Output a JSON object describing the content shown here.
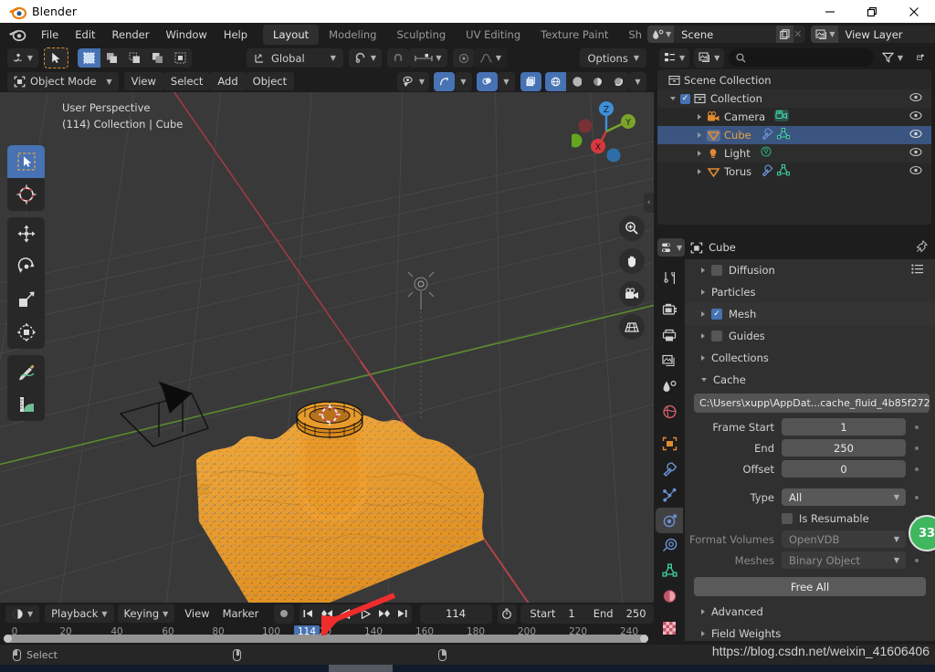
{
  "window": {
    "title": "Blender",
    "controls": {
      "minimize": "—",
      "maximize": "❐",
      "close": "✕"
    }
  },
  "topbar": {
    "menus": [
      "File",
      "Edit",
      "Render",
      "Window",
      "Help"
    ],
    "workspaces": [
      {
        "label": "Layout",
        "active": true
      },
      {
        "label": "Modeling",
        "active": false
      },
      {
        "label": "Sculpting",
        "active": false
      },
      {
        "label": "UV Editing",
        "active": false
      },
      {
        "label": "Texture Paint",
        "active": false
      },
      {
        "label": "Sh",
        "active": false
      }
    ],
    "scene": {
      "value": "Scene",
      "icon": "scene-icon"
    },
    "view_layer": {
      "value": "View Layer",
      "icon": "view-layer-icon"
    }
  },
  "viewport": {
    "tool_header": {
      "transform_orientation": "Global",
      "options_label": "Options",
      "snap_icon": "magnet-icon",
      "proportional_icon": "proportional-edit-icon"
    },
    "mode": "Object Mode",
    "menus": [
      "View",
      "Select",
      "Add",
      "Object"
    ],
    "overlay_text_line1": "User Perspective",
    "overlay_text_line2": "(114) Collection | Cube",
    "gizmo_axes": [
      "Z",
      "Y",
      "X"
    ],
    "nav_buttons": [
      "zoom-icon",
      "hand-icon",
      "camera-icon",
      "grid-icon"
    ],
    "tools": [
      "tweak-select-tool",
      "cursor-tool",
      "move-tool",
      "rotate-tool",
      "scale-tool",
      "transform-tool",
      "annotate-tool",
      "measure-tool"
    ],
    "shading_modes": [
      "wireframe",
      "solid",
      "material-preview",
      "rendered"
    ]
  },
  "timeline": {
    "playback_label": "Playback",
    "keying_label": "Keying",
    "view_label": "View",
    "marker_label": "Marker",
    "current_frame": "114",
    "start_label": "Start",
    "start_value": "1",
    "end_label": "End",
    "end_value": "250",
    "ticks": [
      "0",
      "20",
      "40",
      "60",
      "80",
      "100",
      "120",
      "140",
      "160",
      "180",
      "200",
      "220",
      "240"
    ],
    "playhead_frame": "114"
  },
  "outliner": {
    "search_placeholder": "",
    "root": "Scene Collection",
    "items": [
      {
        "label": "Collection",
        "icon": "collection-icon",
        "depth": 1,
        "checkbox": true,
        "expanded": true,
        "selected": false,
        "badges": []
      },
      {
        "label": "Camera",
        "icon": "camera-obj-icon",
        "depth": 2,
        "checkbox": false,
        "expanded": false,
        "selected": false,
        "badges": [
          "camera-data-icon"
        ]
      },
      {
        "label": "Cube",
        "icon": "mesh-obj-icon",
        "depth": 2,
        "checkbox": false,
        "expanded": false,
        "selected": true,
        "badges": [
          "modifier-icon",
          "mesh-data-icon"
        ]
      },
      {
        "label": "Light",
        "icon": "light-obj-icon",
        "depth": 2,
        "checkbox": false,
        "expanded": false,
        "selected": false,
        "badges": [
          "light-data-icon"
        ]
      },
      {
        "label": "Torus",
        "icon": "mesh-obj-icon",
        "depth": 2,
        "checkbox": false,
        "expanded": false,
        "selected": false,
        "badges": [
          "modifier-icon",
          "mesh-data-icon"
        ]
      }
    ]
  },
  "properties": {
    "breadcrumb": "Cube",
    "tabs": [
      "tool-tab",
      "render-tab",
      "output-tab",
      "view-layer-tab",
      "scene-tab",
      "world-tab",
      "object-tab",
      "modifier-tab",
      "particles-tab",
      "physics-tab",
      "constraints-tab",
      "data-tab",
      "material-tab",
      "texture-tab"
    ],
    "active_tab": "physics-tab",
    "panels": [
      {
        "label": "Diffusion",
        "checkbox": "off",
        "expanded": false,
        "has_preset": true
      },
      {
        "label": "Particles",
        "checkbox": "none",
        "expanded": false,
        "has_preset": false
      },
      {
        "label": "Mesh",
        "checkbox": "on",
        "expanded": false,
        "has_preset": false
      },
      {
        "label": "Guides",
        "checkbox": "off",
        "expanded": false,
        "has_preset": false
      },
      {
        "label": "Collections",
        "checkbox": "none",
        "expanded": false,
        "has_preset": false
      },
      {
        "label": "Cache",
        "checkbox": "none",
        "expanded": true,
        "has_preset": false
      }
    ],
    "cache_path": "C:\\Users\\xupp\\AppDat...cache_fluid_4b85f272",
    "fields": [
      {
        "label": "Frame Start",
        "value": "1",
        "type": "number",
        "dim": false
      },
      {
        "label": "End",
        "value": "250",
        "type": "number",
        "dim": false
      },
      {
        "label": "Offset",
        "value": "0",
        "type": "number",
        "dim": false
      },
      {
        "label": "Type",
        "value": "All",
        "type": "dropdown",
        "dim": false
      },
      {
        "label": "Format Volumes",
        "value": "OpenVDB",
        "type": "dropdown",
        "dim": true
      },
      {
        "label": "Meshes",
        "value": "Binary Object",
        "type": "dropdown",
        "dim": true
      }
    ],
    "is_resumable_label": "Is Resumable",
    "is_resumable_checked": false,
    "free_all_label": "Free All",
    "bottom_panels": [
      "Advanced",
      "Field Weights"
    ],
    "progress_badge": "33"
  },
  "statusbar": {
    "select_label": "Select",
    "watermark": "https://blog.csdn.net/weixin_41606406"
  },
  "colors": {
    "accent_blue": "#4772b3",
    "accent_orange": "#e8a33d",
    "green_badge": "#3eb75e",
    "viewport_bg": "#393939",
    "panel_bg": "#303030"
  }
}
